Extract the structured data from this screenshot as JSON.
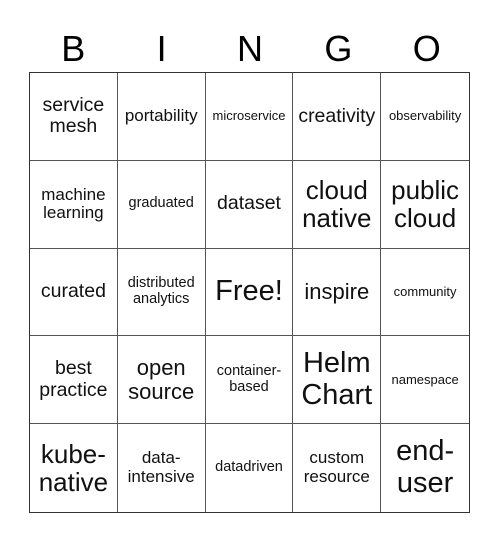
{
  "header": [
    "B",
    "I",
    "N",
    "G",
    "O"
  ],
  "cells": [
    "service mesh",
    "portability",
    "microservice",
    "creativity",
    "observability",
    "machine learning",
    "graduated",
    "dataset",
    "cloud native",
    "public cloud",
    "curated",
    "distributed analytics",
    "Free!",
    "inspire",
    "community",
    "best practice",
    "open source",
    "container-based",
    "Helm Chart",
    "namespace",
    "kube-native",
    "data-intensive",
    "datadriven",
    "custom resource",
    "end-user"
  ]
}
